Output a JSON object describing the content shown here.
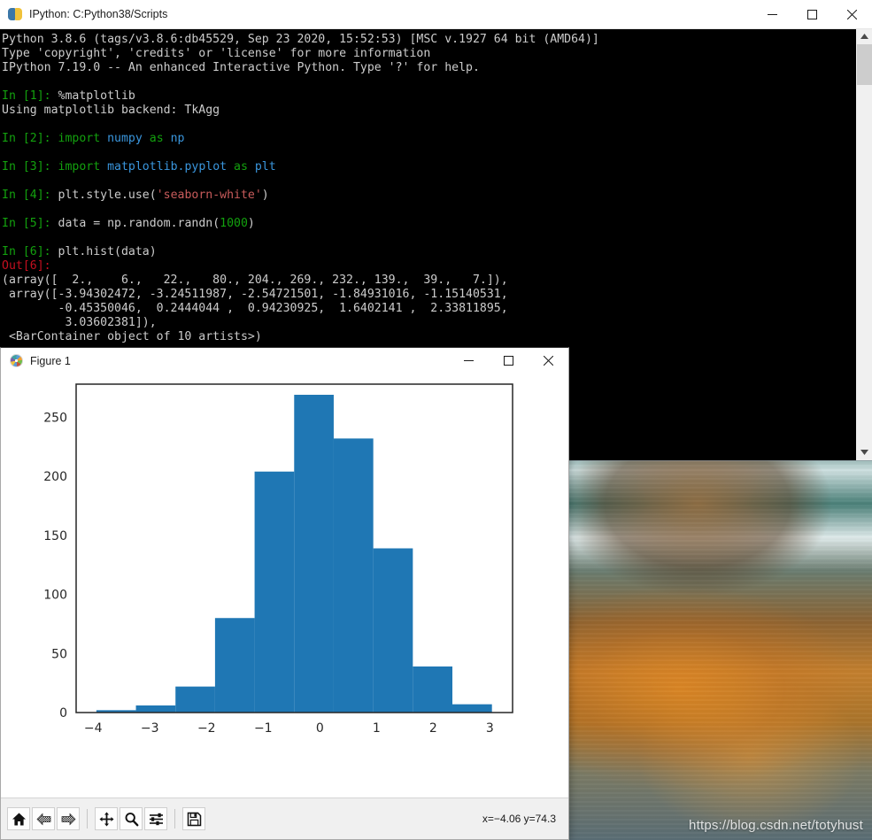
{
  "desktop": {
    "watermark": "https://blog.csdn.net/totyhust",
    "wallpaper_name": "beach-rock-sunset-wallpaper"
  },
  "ipython_window": {
    "title": "IPython: C:Python38/Scripts",
    "icon": "python-icon",
    "controls": {
      "minimize": "–",
      "maximize": "☐",
      "close": "✕"
    },
    "scrollbar": {
      "up_arrow": "▲",
      "down_arrow": "▼"
    },
    "banner": [
      "Python 3.8.6 (tags/v3.8.6:db45529, Sep 23 2020, 15:52:53) [MSC v.1927 64 bit (AMD64)]",
      "Type 'copyright', 'credits' or 'license' for more information",
      "IPython 7.19.0 -- An enhanced Interactive Python. Type '?' for help."
    ],
    "cells": [
      {
        "prompt_in": "In [1]:",
        "code_plain": "%matplotlib",
        "output": [
          "Using matplotlib backend: TkAgg"
        ]
      },
      {
        "prompt_in": "In [2]:",
        "code_kw": "import",
        "code_mod": " numpy ",
        "code_as": "as",
        "code_alias": " np",
        "output": []
      },
      {
        "prompt_in": "In [3]:",
        "code_kw": "import",
        "code_mod": " matplotlib.pyplot ",
        "code_as": "as",
        "code_alias": " plt",
        "output": []
      },
      {
        "prompt_in": "In [4]:",
        "code_pre": "plt.style.use(",
        "code_str": "'seaborn-white'",
        "code_post": ")",
        "output": []
      },
      {
        "prompt_in": "In [5]:",
        "code_pre": "data = np.random.randn(",
        "code_num": "1000",
        "code_post": ")",
        "output": []
      },
      {
        "prompt_in": "In [6]:",
        "code_plain": "plt.hist(data)",
        "prompt_out": "Out[6]:",
        "output": [
          "(array([  2.,    6.,   22.,   80., 204., 269., 232., 139.,  39.,   7.]),",
          " array([-3.94302472, -3.24511987, -2.54721501, -1.84931016, -1.15140531,",
          "        -0.45350046,  0.2444044 ,  0.94230925,  1.6402141 ,  2.33811895,",
          "         3.03602381]),",
          " <BarContainer object of 10 artists>)"
        ]
      }
    ]
  },
  "figure_window": {
    "title": "Figure 1",
    "icon": "matplotlib-icon",
    "controls": {
      "minimize": "–",
      "maximize": "☐",
      "close": "✕"
    },
    "toolbar": {
      "buttons": [
        {
          "name": "home-button",
          "icon": "home-icon",
          "tooltip": "Reset original view"
        },
        {
          "name": "back-button",
          "icon": "left-arrow-icon",
          "tooltip": "Back to previous view"
        },
        {
          "name": "forward-button",
          "icon": "right-arrow-icon",
          "tooltip": "Forward to next view"
        },
        {
          "name": "pan-button",
          "icon": "move-cross-icon",
          "tooltip": "Pan axes with left mouse, zoom with right"
        },
        {
          "name": "zoom-button",
          "icon": "magnifier-icon",
          "tooltip": "Zoom to rectangle"
        },
        {
          "name": "subplots-button",
          "icon": "sliders-icon",
          "tooltip": "Configure subplots"
        },
        {
          "name": "save-button",
          "icon": "floppy-disk-icon",
          "tooltip": "Save the figure"
        }
      ],
      "coordinates": "x=−4.06 y=74.3"
    }
  },
  "chart_data": {
    "type": "bar",
    "title": "",
    "xlabel": "",
    "ylabel": "",
    "bar_color": "#1f77b4",
    "grid": false,
    "legend": false,
    "xlim": [
      -4.3,
      3.4
    ],
    "ylim": [
      0,
      278
    ],
    "xticks": [
      -4,
      -3,
      -2,
      -1,
      0,
      1,
      2,
      3
    ],
    "xtick_labels": [
      "−4",
      "−3",
      "−2",
      "−1",
      "0",
      "1",
      "2",
      "3"
    ],
    "yticks": [
      0,
      50,
      100,
      150,
      200,
      250
    ],
    "ytick_labels": [
      "0",
      "50",
      "100",
      "150",
      "200",
      "250"
    ],
    "bin_edges": [
      -3.94302472,
      -3.24511987,
      -2.54721501,
      -1.84931016,
      -1.15140531,
      -0.45350046,
      0.2444044,
      0.94230925,
      1.6402141,
      2.33811895,
      3.03602381
    ],
    "values": [
      2,
      6,
      22,
      80,
      204,
      269,
      232,
      139,
      39,
      7
    ],
    "categories": [
      "-3.94 to -3.25",
      "-3.25 to -2.55",
      "-2.55 to -1.85",
      "-1.85 to -1.15",
      "-1.15 to -0.45",
      "-0.45 to 0.24",
      "0.24 to 0.94",
      "0.94 to 1.64",
      "1.64 to 2.34",
      "2.34 to 3.04"
    ],
    "n_samples": 1000
  }
}
